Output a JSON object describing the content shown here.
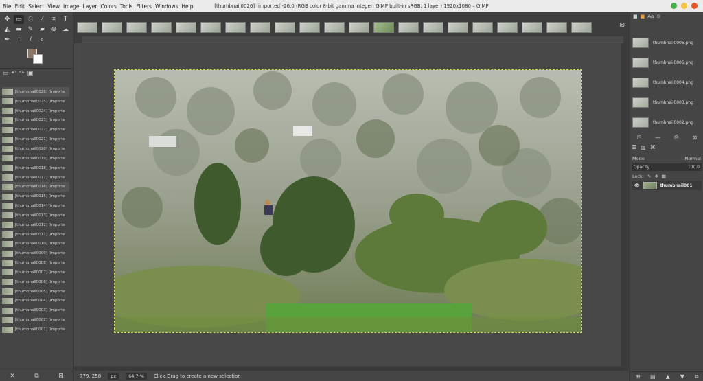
{
  "menu": [
    "File",
    "Edit",
    "Select",
    "View",
    "Image",
    "Layer",
    "Colors",
    "Tools",
    "Filters",
    "Windows",
    "Help"
  ],
  "window_title": "[thumbnail0026] (imported)-26.0 (RGB color 8-bit gamma integer, GIMP built-in sRGB, 1 layer) 1920x1080 – GIMP",
  "colors": {
    "titlebar": "#ebebeb",
    "dock": "#454545",
    "canvas": "#3d3d3d",
    "selection": "#d6d65a",
    "close_btn": "#e95420",
    "min_btn": "#4caf50",
    "max_btn": "#f5c542"
  },
  "images": [
    "[thumbnail0026] (importe",
    "[thumbnail0025] (importe",
    "[thumbnail0024] (importe",
    "[thumbnail0023] (importe",
    "[thumbnail0022] (importe",
    "[thumbnail0021] (importe",
    "[thumbnail0020] (importe",
    "[thumbnail0019] (importe",
    "[thumbnail0018] (importe",
    "[thumbnail0017] (importe",
    "[thumbnail0016] (importe",
    "[thumbnail0015] (importe",
    "[thumbnail0014] (importe",
    "[thumbnail0013] (importe",
    "[thumbnail0012] (importe",
    "[thumbnail0011] (importe",
    "[thumbnail0010] (importe",
    "[thumbnail0009] (importe",
    "[thumbnail0008] (importe",
    "[thumbnail0007] (importe",
    "[thumbnail0006] (importe",
    "[thumbnail0005] (importe",
    "[thumbnail0004] (importe",
    "[thumbnail0003] (importe",
    "[thumbnail0002] (importe",
    "[thumbnail0001] (importe"
  ],
  "right_files": [
    "thumbnail0006.png",
    "thumbnail0005.png",
    "thumbnail0004.png",
    "thumbnail0003.png",
    "thumbnail0002.png"
  ],
  "status": {
    "coords": "779, 258",
    "unit": "px",
    "zoom": "64.7 %",
    "message": "Click-Drag to create a new selection"
  },
  "layers": {
    "mode_label": "Mode",
    "mode_value": "Normal",
    "opacity_label": "Opacity",
    "opacity_value": "100.0",
    "lock_label": "Lock:",
    "layer_name": "thumbnail001"
  }
}
